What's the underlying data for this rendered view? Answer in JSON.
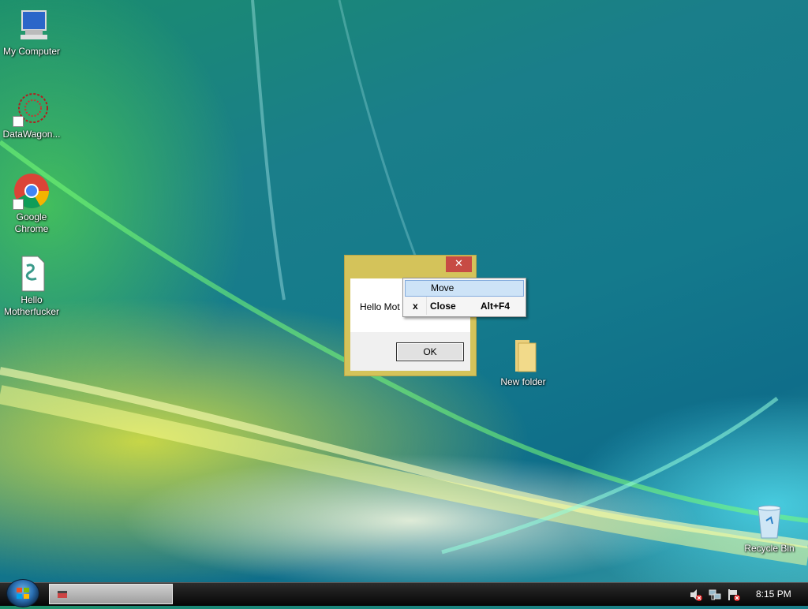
{
  "desktop": {
    "icons": [
      {
        "label": "My Computer"
      },
      {
        "label": "DataWagon..."
      },
      {
        "label": "Google Chrome"
      },
      {
        "label": "Hello Motherfucker"
      },
      {
        "label": "New folder"
      },
      {
        "label": "Recycle Bin"
      }
    ]
  },
  "dialog": {
    "close_glyph": "✕",
    "message": "Hello Mot",
    "ok_label": "OK"
  },
  "context_menu": {
    "items": [
      {
        "label": "Move",
        "accelerator": "",
        "mark": "",
        "highlighted": true
      },
      {
        "label": "Close",
        "accelerator": "Alt+F4",
        "mark": "x",
        "highlighted": false
      }
    ]
  },
  "taskbar": {
    "clock": "8:15 PM",
    "tray_icons": [
      "speaker-muted-icon",
      "network-icon",
      "flag-alert-icon"
    ]
  },
  "colors": {
    "dialog_frame": "#d4c35a",
    "close_button": "#c74b44",
    "menu_highlight": "#cde3f7"
  }
}
